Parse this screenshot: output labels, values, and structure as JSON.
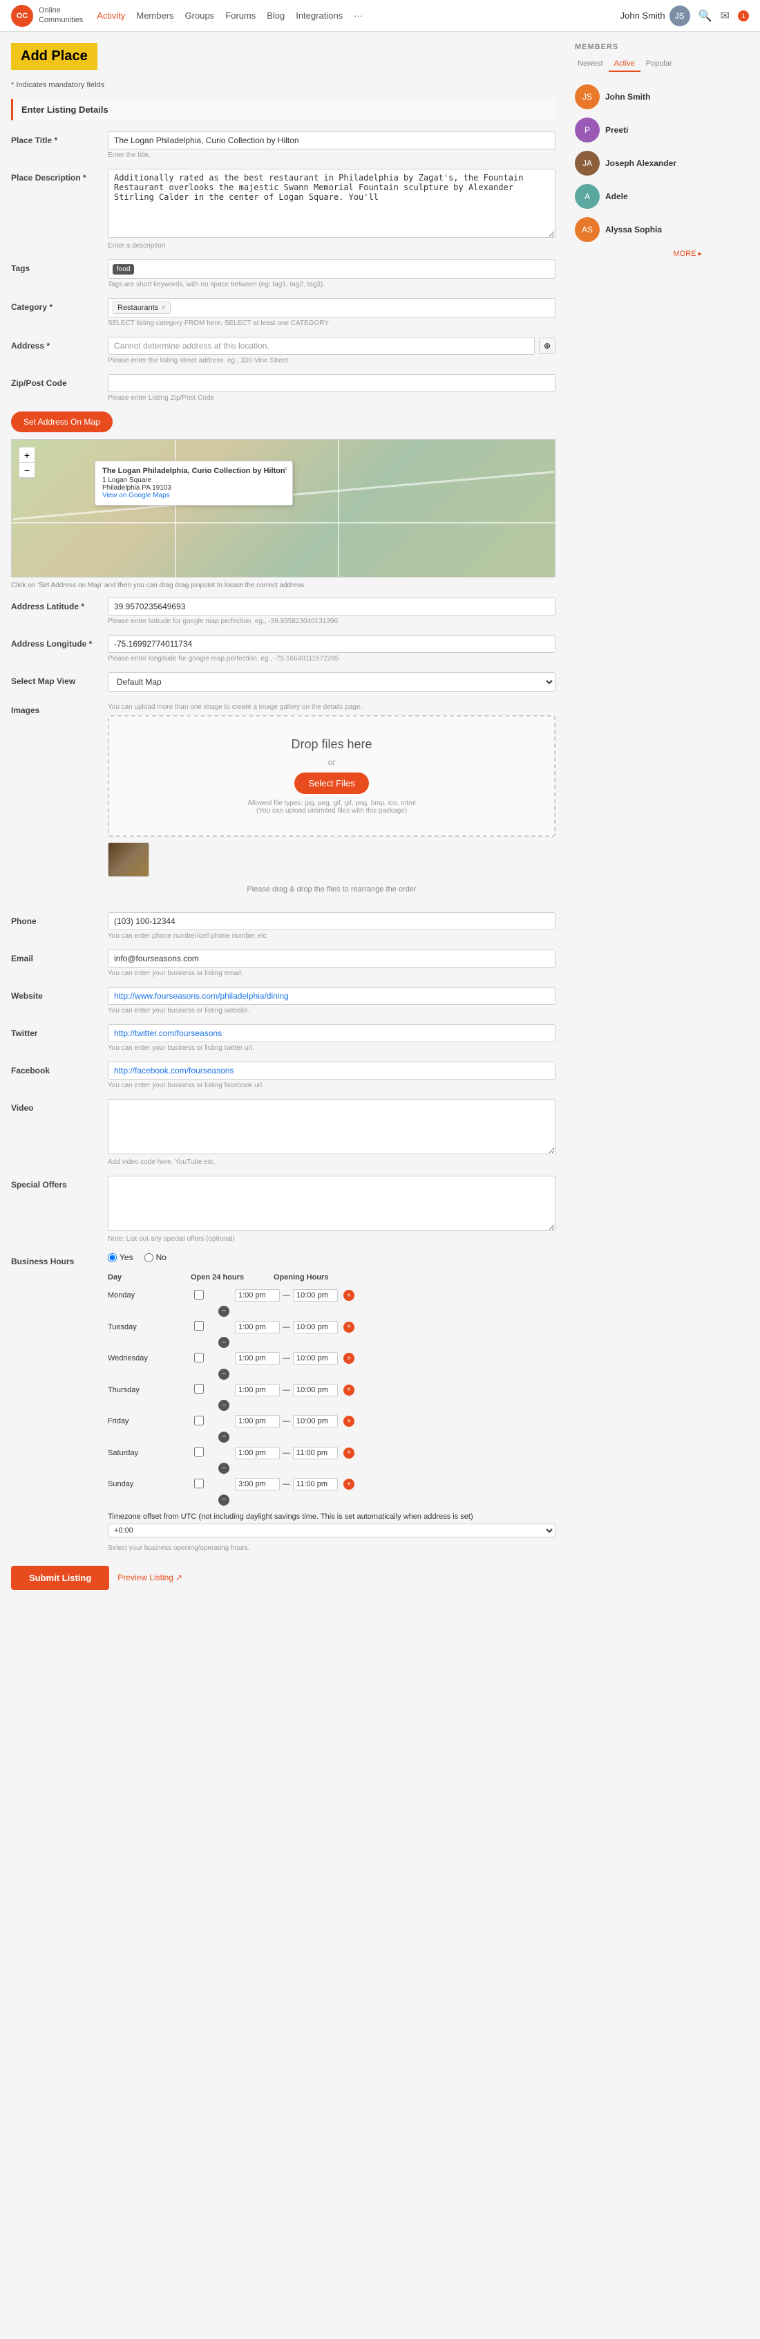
{
  "nav": {
    "logo_text": "OC",
    "brand_line1": "Online",
    "brand_line2": "Communities",
    "links": [
      {
        "label": "Activity",
        "active": true
      },
      {
        "label": "Members"
      },
      {
        "label": "Groups"
      },
      {
        "label": "Forums",
        "has_dropdown": true
      },
      {
        "label": "Blog",
        "has_dropdown": true
      },
      {
        "label": "Integrations",
        "has_dropdown": true
      },
      {
        "label": "···"
      }
    ],
    "user_name": "John Smith",
    "notification_count": "1"
  },
  "page": {
    "title": "Add Place",
    "mandatory_note": "* Indicates mandatory fields",
    "section_label": "Enter Listing Details"
  },
  "form": {
    "place_title_label": "Place Title *",
    "place_title_value": "The Logan Philadelphia, Curio Collection by Hilton",
    "place_title_hint": "Enter the title.",
    "place_description_label": "Place Description *",
    "place_description_value": "Additionally rated as the best restaurant in Philadelphia by Zagat's, the Fountain Restaurant overlooks the majestic Swann Memorial Fountain sculpture by Alexander Stirling Calder in the center of Logan Square. You'll",
    "place_description_hint": "Enter a description",
    "tags_label": "Tags",
    "tags_value": "food",
    "tags_hint": "Tags are short keywords, with no space between (eg: tag1, tag2, tag3).",
    "category_label": "Category *",
    "category_value": "Restaurants",
    "category_hint": "SELECT listing category FROM here. SELECT at least one CATEGORY",
    "address_label": "Address *",
    "address_value": "Cannot determine address at this location.",
    "address_hint": "Please enter the listing street address. eg., 330 Vine Street",
    "zip_label": "Zip/Post Code",
    "zip_value": "",
    "zip_hint": "Please enter Listing Zip/Post Code",
    "set_address_btn": "Set Address On Map",
    "map_popup_title": "The Logan Philadelphia, Curio Collection by Hilton",
    "map_popup_address": "1 Logan Square",
    "map_popup_city": "Philadelphia PA 19103",
    "map_popup_link": "View on Google Maps",
    "map_hint": "Click on 'Set Address on Map' and then you can drag drag pinpoint to locate the correct address",
    "lat_label": "Address Latitude *",
    "lat_value": "39.9570235649693",
    "lat_hint": "Please enter latitude for google map perfection. eg., -39.935823040131396",
    "lng_label": "Address Longitude *",
    "lng_value": "-75.16992774011734",
    "lng_hint": "Please enter longitude for google map perfection. eg., -75.16640111572285",
    "map_view_label": "Select Map View",
    "map_view_value": "Default Map",
    "images_label": "Images",
    "images_note": "You can upload more than one image to create a image gallery on the details page.",
    "upload_title": "Drop files here",
    "upload_or": "or",
    "select_files_btn": "Select Files",
    "upload_allowed": "Allowed file types: jpg, peg, gif, gif, png, bmp, ico, mtml\n(You can upload unlimited files with this package)",
    "drag_drop_hint": "Please drag & drop the files to rearrange the order",
    "phone_label": "Phone",
    "phone_value": "(103) 100-12344",
    "phone_hint": "You can enter phone number/cell phone number etc",
    "email_label": "Email",
    "email_value": "info@fourseasons.com",
    "email_hint": "You can enter your business or listing email.",
    "website_label": "Website",
    "website_value": "http://www.fourseasons.com/philadelphia/dining",
    "website_hint": "You can enter your business or listing website.",
    "twitter_label": "Twitter",
    "twitter_value": "http://twitter.com/fourseasons",
    "twitter_hint": "You can enter your business or listing twitter url.",
    "facebook_label": "Facebook",
    "facebook_value": "http://facebook.com/fourseasons",
    "facebook_hint": "You can enter your business or listing facebook url.",
    "video_label": "Video",
    "video_value": "",
    "video_hint": "Add video code here. YouTube etc.",
    "special_offers_label": "Special Offers",
    "special_offers_value": "",
    "special_offers_hint": "Note: List out any special offers (optional)",
    "business_hours_label": "Business Hours",
    "yes_label": "Yes",
    "no_label": "No",
    "hours_day_col": "Day",
    "hours_open24_col": "Open 24 hours",
    "hours_opening_col": "Opening Hours",
    "timezone_label": "Timezone offset from UTC (not including daylight savings time. This is set automatically when address is set)",
    "timezone_value": "+0:00",
    "business_system_label": "Select your business opening/operating hours.",
    "submit_btn": "Submit Listing",
    "preview_link": "Preview Listing"
  },
  "hours": [
    {
      "day": "Monday",
      "open_from": "1:00 pm",
      "open_to": "10:00 pm"
    },
    {
      "day": "Tuesday",
      "open_from": "1:00 pm",
      "open_to": "10:00 pm"
    },
    {
      "day": "Wednesday",
      "open_from": "1:00 pm",
      "open_to": "10:00 pm"
    },
    {
      "day": "Thursday",
      "open_from": "1:00 pm",
      "open_to": "10:00 pm"
    },
    {
      "day": "Friday",
      "open_from": "1:00 pm",
      "open_to": "10:00 pm"
    },
    {
      "day": "Saturday",
      "open_from": "1:00 pm",
      "open_to": "11:00 pm"
    },
    {
      "day": "Sunday",
      "open_from": "3:00 pm",
      "open_to": "11:00 pm"
    }
  ],
  "sidebar": {
    "members_title": "MEMBERS",
    "tabs": [
      "Newest",
      "Active",
      "Popular"
    ],
    "active_tab": "Active",
    "members": [
      {
        "name": "John Smith",
        "avatar_color": "orange"
      },
      {
        "name": "Preeti",
        "avatar_color": "purple"
      },
      {
        "name": "Joseph Alexander",
        "avatar_color": "brown"
      },
      {
        "name": "Adele",
        "avatar_color": "teal"
      },
      {
        "name": "Alyssa Sophia",
        "avatar_color": "orange"
      }
    ],
    "more_label": "MORE ▸"
  }
}
